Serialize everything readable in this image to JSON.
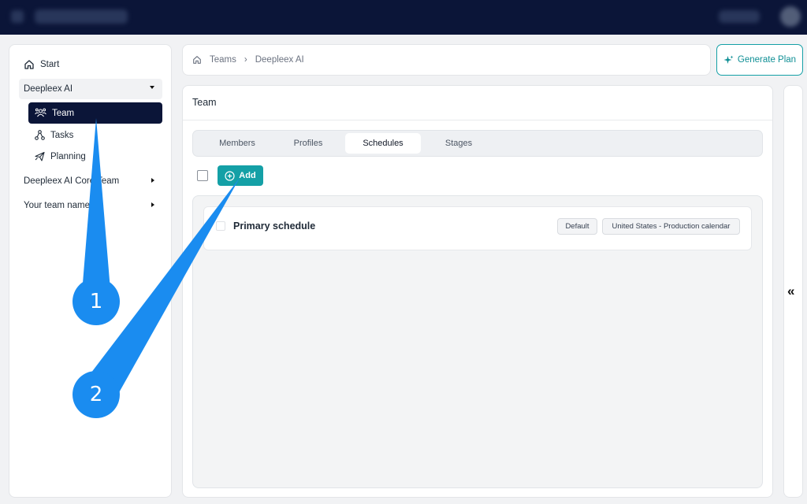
{
  "sidebar": {
    "start_label": "Start",
    "groups": [
      {
        "label": "Deepleex AI"
      },
      {
        "label": "Deepleex AI Core Team"
      },
      {
        "label": "Your team name"
      }
    ],
    "sub_items": [
      {
        "label": "Team"
      },
      {
        "label": "Tasks"
      },
      {
        "label": "Planning"
      }
    ]
  },
  "breadcrumb": {
    "items": [
      "Teams",
      "Deepleex AI"
    ]
  },
  "actions": {
    "generate_plan": "Generate Plan"
  },
  "main": {
    "title": "Team",
    "tabs": [
      "Members",
      "Profiles",
      "Schedules",
      "Stages"
    ],
    "active_tab": "Schedules",
    "add_label": "Add",
    "schedules": [
      {
        "name": "Primary schedule",
        "badges": [
          "Default",
          "United States - Production calendar"
        ]
      }
    ]
  },
  "rail": {
    "collapse_glyph": "«"
  },
  "callouts": [
    "1",
    "2"
  ],
  "colors": {
    "accent": "#14a0a6",
    "navy": "#0b1538",
    "callout": "#1a8cf0"
  }
}
